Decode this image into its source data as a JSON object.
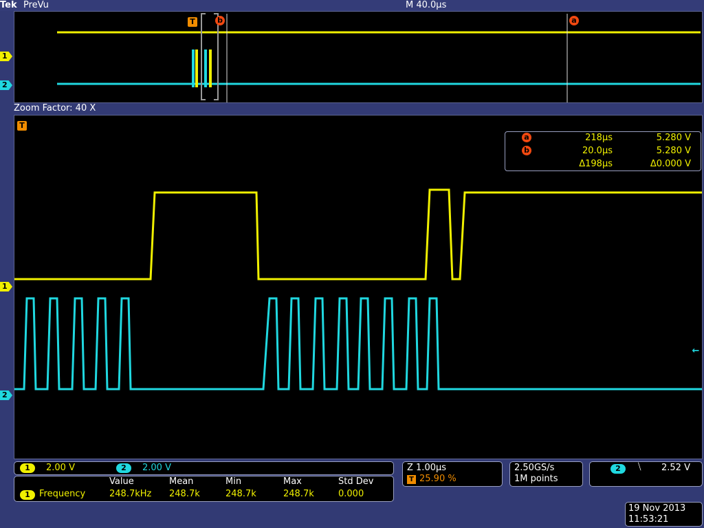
{
  "header": {
    "brand": "Tek",
    "mode": "PreVu",
    "main_timebase": "M 40.0µs"
  },
  "overview": {
    "trigger_marker": "T",
    "cursor_a_marker": "a",
    "cursor_b_marker": "b",
    "ch1_marker": "1",
    "ch2_marker": "2"
  },
  "zoom": {
    "factor_label": "Zoom Factor: 40 X",
    "trigger_marker": "T",
    "ch1_marker": "1",
    "ch2_marker": "2",
    "trigger_level_marker": "←"
  },
  "cursor_readout": {
    "a": {
      "label": "a",
      "time": "218µs",
      "volt": "5.280 V"
    },
    "b": {
      "label": "b",
      "time": "20.0µs",
      "volt": "5.280 V"
    },
    "delta": {
      "time": "Δ198µs",
      "volt": "Δ0.000 V"
    }
  },
  "channels": {
    "ch1": {
      "badge": "1",
      "scale": "2.00 V",
      "color": "#f0f000"
    },
    "ch2": {
      "badge": "2",
      "scale": "2.00 V",
      "color": "#20d8e0"
    }
  },
  "measurement": {
    "headers": [
      "Value",
      "Mean",
      "Min",
      "Max",
      "Std Dev"
    ],
    "badge": "1",
    "name": "Frequency",
    "values": [
      "248.7kHz",
      "248.7k",
      "248.7k",
      "248.7k",
      "0.000"
    ]
  },
  "zoom_panel": {
    "zoom_scale": "Z 1.00µs",
    "trigger_badge": "T",
    "trigger_pos": "25.90 %"
  },
  "acquisition": {
    "sample_rate": "2.50GS/s",
    "record_length": "1M points"
  },
  "trigger": {
    "source_badge": "2",
    "slope_symbol": "⧹",
    "slope_icon": "falling-edge-icon",
    "level": "2.52 V"
  },
  "datetime": {
    "date": "19 Nov 2013",
    "time": "11:53:21"
  }
}
